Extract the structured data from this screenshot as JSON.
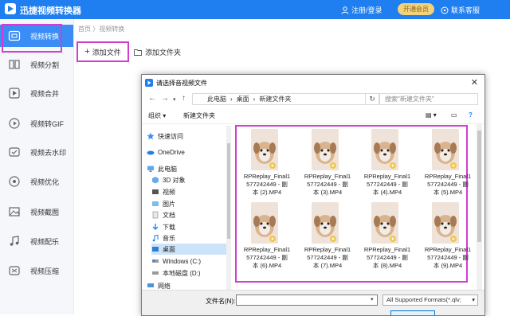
{
  "app": {
    "title": "迅捷视频转换器",
    "login_label": "注册/登录",
    "vip_label": "开通会员",
    "contact_label": "联系客服"
  },
  "sidebar": {
    "items": [
      {
        "label": "视频转换",
        "icon": "convert-icon"
      },
      {
        "label": "视频分割",
        "icon": "split-icon"
      },
      {
        "label": "视频合并",
        "icon": "merge-icon"
      },
      {
        "label": "视频转GIF",
        "icon": "gif-icon"
      },
      {
        "label": "视频去水印",
        "icon": "watermark-icon"
      },
      {
        "label": "视频优化",
        "icon": "optimize-icon"
      },
      {
        "label": "视频截图",
        "icon": "screenshot-icon"
      },
      {
        "label": "视频配乐",
        "icon": "music-icon"
      },
      {
        "label": "视频压缩",
        "icon": "compress-icon"
      }
    ]
  },
  "breadcrumb": "首页 〉视频转换",
  "toolbar": {
    "add_file": "添加文件",
    "add_folder": "添加文件夹"
  },
  "dialog": {
    "title": "请选择音视频文件",
    "address": [
      "此电脑",
      "桌面",
      "新建文件夹"
    ],
    "search_placeholder": "搜索\"新建文件夹\"",
    "organize": "组织",
    "new_folder": "新建文件夹",
    "nav": [
      {
        "label": "快速访问",
        "icon": "star-icon"
      },
      {
        "label": "OneDrive",
        "icon": "cloud-icon"
      },
      {
        "label": "此电脑",
        "icon": "pc-icon"
      },
      {
        "label": "3D 对象",
        "icon": "cube-icon"
      },
      {
        "label": "视频",
        "icon": "video-icon"
      },
      {
        "label": "图片",
        "icon": "picture-icon"
      },
      {
        "label": "文档",
        "icon": "document-icon"
      },
      {
        "label": "下载",
        "icon": "download-icon"
      },
      {
        "label": "音乐",
        "icon": "music-icon"
      },
      {
        "label": "桌面",
        "icon": "desktop-icon"
      },
      {
        "label": "Windows (C:)",
        "icon": "drive-icon"
      },
      {
        "label": "本地磁盘 (D:)",
        "icon": "drive-icon"
      },
      {
        "label": "网络",
        "icon": "network-icon"
      }
    ],
    "files": [
      {
        "line1": "RPReplay_Final1",
        "line2": "577242449 - 副",
        "line3": "本 (2).MP4"
      },
      {
        "line1": "RPReplay_Final1",
        "line2": "577242449 - 副",
        "line3": "本 (3).MP4"
      },
      {
        "line1": "RPReplay_Final1",
        "line2": "577242449 - 副",
        "line3": "本 (4).MP4"
      },
      {
        "line1": "RPReplay_Final1",
        "line2": "577242449 - 副",
        "line3": "本 (5).MP4"
      },
      {
        "line1": "RPReplay_Final1",
        "line2": "577242449 - 副",
        "line3": "本 (6).MP4"
      },
      {
        "line1": "RPReplay_Final1",
        "line2": "577242449 - 副",
        "line3": "本 (7).MP4"
      },
      {
        "line1": "RPReplay_Final1",
        "line2": "577242449 - 副",
        "line3": "本 (8).MP4"
      },
      {
        "line1": "RPReplay_Final1",
        "line2": "577242449 - 副",
        "line3": "本 (9).MP4"
      }
    ],
    "filename_label": "文件名(N):",
    "filename_value": "",
    "filetype_value": "All Supported Formats(*.qlv;"
  },
  "colors": {
    "brand": "#1f7ff0",
    "sidebar_active": "#3a8df5",
    "highlight": "#d23cd3"
  }
}
